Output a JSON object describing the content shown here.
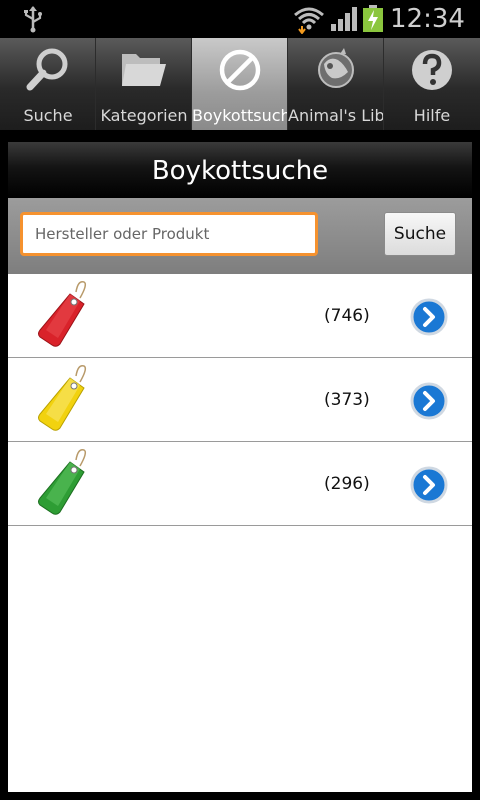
{
  "status_bar": {
    "time": "12:34",
    "icons": [
      "usb-icon",
      "wifi-icon",
      "signal-icon",
      "battery-charging-icon"
    ]
  },
  "tabs": [
    {
      "label": "Suche",
      "icon": "magnifier-icon",
      "active": false
    },
    {
      "label": "Kategorien",
      "icon": "folder-icon",
      "active": false
    },
    {
      "label": "Boykottsuche",
      "icon": "prohibited-icon",
      "active": true
    },
    {
      "label": "Animal's Liberation",
      "icon": "globe-animals-icon",
      "active": false
    },
    {
      "label": "Hilfe",
      "icon": "help-icon",
      "active": false
    }
  ],
  "header": {
    "title": "Boykottsuche"
  },
  "search": {
    "placeholder": "Hersteller oder Produkt",
    "value": "",
    "button_label": "Suche"
  },
  "list": [
    {
      "tag_color": "#d9222a",
      "count": "(746)",
      "icon": "red-tag-icon"
    },
    {
      "tag_color": "#f2d20f",
      "count": "(373)",
      "icon": "yellow-tag-icon"
    },
    {
      "tag_color": "#2e9d34",
      "count": "(296)",
      "icon": "green-tag-icon"
    }
  ],
  "colors": {
    "accent_focus": "#f5922f",
    "chevron_blue": "#1a78d4"
  }
}
